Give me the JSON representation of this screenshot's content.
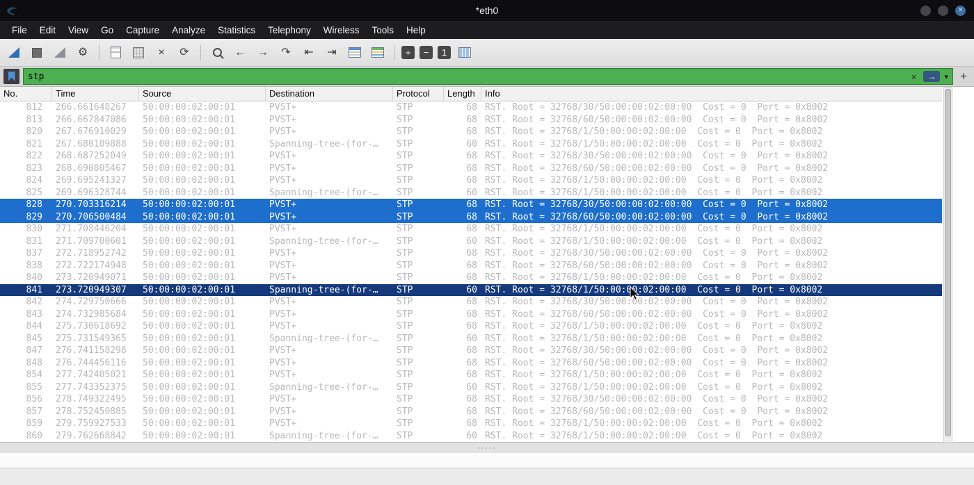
{
  "window": {
    "title": "*eth0",
    "close_glyph": "×"
  },
  "menu_bar": {
    "items": [
      "File",
      "Edit",
      "View",
      "Go",
      "Capture",
      "Analyze",
      "Statistics",
      "Telephony",
      "Wireless",
      "Tools",
      "Help"
    ]
  },
  "toolbar": {
    "items": [
      {
        "name": "start-capture",
        "shape": "fin-blue"
      },
      {
        "name": "stop-capture",
        "shape": "stop-square"
      },
      {
        "name": "restart-capture",
        "shape": "fin-gray"
      },
      {
        "name": "capture-options",
        "glyph": "⚙"
      },
      {
        "type": "sep"
      },
      {
        "name": "open-file",
        "shape": "doc"
      },
      {
        "name": "save-file",
        "shape": "gridic"
      },
      {
        "name": "close-file",
        "glyph": "×"
      },
      {
        "name": "reload",
        "glyph": "⟳"
      },
      {
        "type": "sep"
      },
      {
        "name": "find-packet",
        "shape": "magnifier"
      },
      {
        "name": "go-back",
        "glyph": "←"
      },
      {
        "name": "go-forward",
        "glyph": "→"
      },
      {
        "name": "go-to-packet",
        "glyph": "↷"
      },
      {
        "name": "first-packet",
        "glyph": "⇤"
      },
      {
        "name": "last-packet",
        "glyph": "⇥"
      },
      {
        "name": "auto-scroll",
        "shape": "panel-blue"
      },
      {
        "name": "colorize",
        "shape": "panel-color"
      },
      {
        "type": "sep"
      },
      {
        "name": "zoom-in",
        "cls": "zoom",
        "glyph": "+"
      },
      {
        "name": "zoom-out",
        "cls": "zoom",
        "glyph": "−"
      },
      {
        "name": "zoom-100",
        "cls": "zoom",
        "glyph": "1"
      },
      {
        "name": "resize-columns",
        "shape": "grid-col"
      }
    ]
  },
  "filter_bar": {
    "value": "stp",
    "clear_glyph": "×",
    "apply_glyph": "→",
    "dropdown_glyph": "▾",
    "add_glyph": "+"
  },
  "splitter": {
    "handle": "·····"
  },
  "colors": {
    "filter_valid_bg": "#4caf50",
    "selection_bg": "#1d6ecd",
    "current_selection_bg": "#15397b",
    "row_text": "#b8b8b8",
    "titlebar_bg": "#0d0d10"
  },
  "packet_table": {
    "columns": [
      "No.",
      "Time",
      "Source",
      "Destination",
      "Protocol",
      "Length",
      "Info"
    ],
    "rows": [
      {
        "no": "812",
        "time": "266.661648267",
        "source": "50:00:00:02:00:01",
        "destination": "PVST+",
        "protocol": "STP",
        "length": "68",
        "info": "RST. Root = 32768/30/50:00:00:02:00:00  Cost = 0  Port = 0x8002",
        "state": "normal"
      },
      {
        "no": "813",
        "time": "266.667847086",
        "source": "50:00:00:02:00:01",
        "destination": "PVST+",
        "protocol": "STP",
        "length": "68",
        "info": "RST. Root = 32768/60/50:00:00:02:00:00  Cost = 0  Port = 0x8002",
        "state": "normal"
      },
      {
        "no": "820",
        "time": "267.676910029",
        "source": "50:00:00:02:00:01",
        "destination": "PVST+",
        "protocol": "STP",
        "length": "68",
        "info": "RST. Root = 32768/1/50:00:00:02:00:00  Cost = 0  Port = 0x8002",
        "state": "normal"
      },
      {
        "no": "821",
        "time": "267.680109888",
        "source": "50:00:00:02:00:01",
        "destination": "Spanning-tree-(for-…",
        "protocol": "STP",
        "length": "60",
        "info": "RST. Root = 32768/1/50:00:00:02:00:00  Cost = 0  Port = 0x8002",
        "state": "normal"
      },
      {
        "no": "822",
        "time": "268.687252049",
        "source": "50:00:00:02:00:01",
        "destination": "PVST+",
        "protocol": "STP",
        "length": "68",
        "info": "RST. Root = 32768/30/50:00:00:02:00:00  Cost = 0  Port = 0x8002",
        "state": "normal"
      },
      {
        "no": "823",
        "time": "268.690805467",
        "source": "50:00:00:02:00:01",
        "destination": "PVST+",
        "protocol": "STP",
        "length": "68",
        "info": "RST. Root = 32768/60/50:00:00:02:00:00  Cost = 0  Port = 0x8002",
        "state": "normal"
      },
      {
        "no": "824",
        "time": "269.695241327",
        "source": "50:00:00:02:00:01",
        "destination": "PVST+",
        "protocol": "STP",
        "length": "68",
        "info": "RST. Root = 32768/1/50:00:00:02:00:00  Cost = 0  Port = 0x8002",
        "state": "normal"
      },
      {
        "no": "825",
        "time": "269.696328744",
        "source": "50:00:00:02:00:01",
        "destination": "Spanning-tree-(for-…",
        "protocol": "STP",
        "length": "60",
        "info": "RST. Root = 32768/1/50:00:00:02:00:00  Cost = 0  Port = 0x8002",
        "state": "normal"
      },
      {
        "no": "828",
        "time": "270.703316214",
        "source": "50:00:00:02:00:01",
        "destination": "PVST+",
        "protocol": "STP",
        "length": "68",
        "info": "RST. Root = 32768/30/50:00:00:02:00:00  Cost = 0  Port = 0x8002",
        "state": "selected"
      },
      {
        "no": "829",
        "time": "270.706500484",
        "source": "50:00:00:02:00:01",
        "destination": "PVST+",
        "protocol": "STP",
        "length": "68",
        "info": "RST. Root = 32768/60/50:00:00:02:00:00  Cost = 0  Port = 0x8002",
        "state": "selected"
      },
      {
        "no": "830",
        "time": "271.708446204",
        "source": "50:00:00:02:00:01",
        "destination": "PVST+",
        "protocol": "STP",
        "length": "68",
        "info": "RST. Root = 32768/1/50:00:00:02:00:00  Cost = 0  Port = 0x8002",
        "state": "normal"
      },
      {
        "no": "831",
        "time": "271.709700601",
        "source": "50:00:00:02:00:01",
        "destination": "Spanning-tree-(for-…",
        "protocol": "STP",
        "length": "60",
        "info": "RST. Root = 32768/1/50:00:00:02:00:00  Cost = 0  Port = 0x8002",
        "state": "normal"
      },
      {
        "no": "837",
        "time": "272.718952742",
        "source": "50:00:00:02:00:01",
        "destination": "PVST+",
        "protocol": "STP",
        "length": "68",
        "info": "RST. Root = 32768/30/50:00:00:02:00:00  Cost = 0  Port = 0x8002",
        "state": "normal"
      },
      {
        "no": "838",
        "time": "272.722174948",
        "source": "50:00:00:02:00:01",
        "destination": "PVST+",
        "protocol": "STP",
        "length": "68",
        "info": "RST. Root = 32768/60/50:00:00:02:00:00  Cost = 0  Port = 0x8002",
        "state": "normal"
      },
      {
        "no": "840",
        "time": "273.720949071",
        "source": "50:00:00:02:00:01",
        "destination": "PVST+",
        "protocol": "STP",
        "length": "68",
        "info": "RST. Root = 32768/1/50:00:00:02:00:00  Cost = 0  Port = 0x8002",
        "state": "normal"
      },
      {
        "no": "841",
        "time": "273.720949307",
        "source": "50:00:00:02:00:01",
        "destination": "Spanning-tree-(for-…",
        "protocol": "STP",
        "length": "60",
        "info": "RST. Root = 32768/1/50:00:00:02:00:00  Cost = 0  Port = 0x8002",
        "state": "current"
      },
      {
        "no": "842",
        "time": "274.729750666",
        "source": "50:00:00:02:00:01",
        "destination": "PVST+",
        "protocol": "STP",
        "length": "68",
        "info": "RST. Root = 32768/30/50:00:00:02:00:00  Cost = 0  Port = 0x8002",
        "state": "normal"
      },
      {
        "no": "843",
        "time": "274.732985684",
        "source": "50:00:00:02:00:01",
        "destination": "PVST+",
        "protocol": "STP",
        "length": "68",
        "info": "RST. Root = 32768/60/50:00:00:02:00:00  Cost = 0  Port = 0x8002",
        "state": "normal"
      },
      {
        "no": "844",
        "time": "275.730618692",
        "source": "50:00:00:02:00:01",
        "destination": "PVST+",
        "protocol": "STP",
        "length": "68",
        "info": "RST. Root = 32768/1/50:00:00:02:00:00  Cost = 0  Port = 0x8002",
        "state": "normal"
      },
      {
        "no": "845",
        "time": "275.731549365",
        "source": "50:00:00:02:00:01",
        "destination": "Spanning-tree-(for-…",
        "protocol": "STP",
        "length": "60",
        "info": "RST. Root = 32768/1/50:00:00:02:00:00  Cost = 0  Port = 0x8002",
        "state": "normal"
      },
      {
        "no": "847",
        "time": "276.741158298",
        "source": "50:00:00:02:00:01",
        "destination": "PVST+",
        "protocol": "STP",
        "length": "68",
        "info": "RST. Root = 32768/30/50:00:00:02:00:00  Cost = 0  Port = 0x8002",
        "state": "normal"
      },
      {
        "no": "848",
        "time": "276.744456116",
        "source": "50:00:00:02:00:01",
        "destination": "PVST+",
        "protocol": "STP",
        "length": "68",
        "info": "RST. Root = 32768/60/50:00:00:02:00:00  Cost = 0  Port = 0x8002",
        "state": "normal"
      },
      {
        "no": "854",
        "time": "277.742405021",
        "source": "50:00:00:02:00:01",
        "destination": "PVST+",
        "protocol": "STP",
        "length": "68",
        "info": "RST. Root = 32768/1/50:00:00:02:00:00  Cost = 0  Port = 0x8002",
        "state": "normal"
      },
      {
        "no": "855",
        "time": "277.743352375",
        "source": "50:00:00:02:00:01",
        "destination": "Spanning-tree-(for-…",
        "protocol": "STP",
        "length": "60",
        "info": "RST. Root = 32768/1/50:00:00:02:00:00  Cost = 0  Port = 0x8002",
        "state": "normal"
      },
      {
        "no": "856",
        "time": "278.749322495",
        "source": "50:00:00:02:00:01",
        "destination": "PVST+",
        "protocol": "STP",
        "length": "68",
        "info": "RST. Root = 32768/30/50:00:00:02:00:00  Cost = 0  Port = 0x8002",
        "state": "normal"
      },
      {
        "no": "857",
        "time": "278.752450885",
        "source": "50:00:00:02:00:01",
        "destination": "PVST+",
        "protocol": "STP",
        "length": "68",
        "info": "RST. Root = 32768/60/50:00:00:02:00:00  Cost = 0  Port = 0x8002",
        "state": "normal"
      },
      {
        "no": "859",
        "time": "279.759927533",
        "source": "50:00:00:02:00:01",
        "destination": "PVST+",
        "protocol": "STP",
        "length": "68",
        "info": "RST. Root = 32768/1/50:00:00:02:00:00  Cost = 0  Port = 0x8002",
        "state": "normal"
      },
      {
        "no": "860",
        "time": "279.762668842",
        "source": "50:00:00:02:00:01",
        "destination": "Spanning-tree-(for-…",
        "protocol": "STP",
        "length": "60",
        "info": "RST. Root = 32768/1/50:00:00:02:00:00  Cost = 0  Port = 0x8002",
        "state": "normal"
      }
    ]
  }
}
